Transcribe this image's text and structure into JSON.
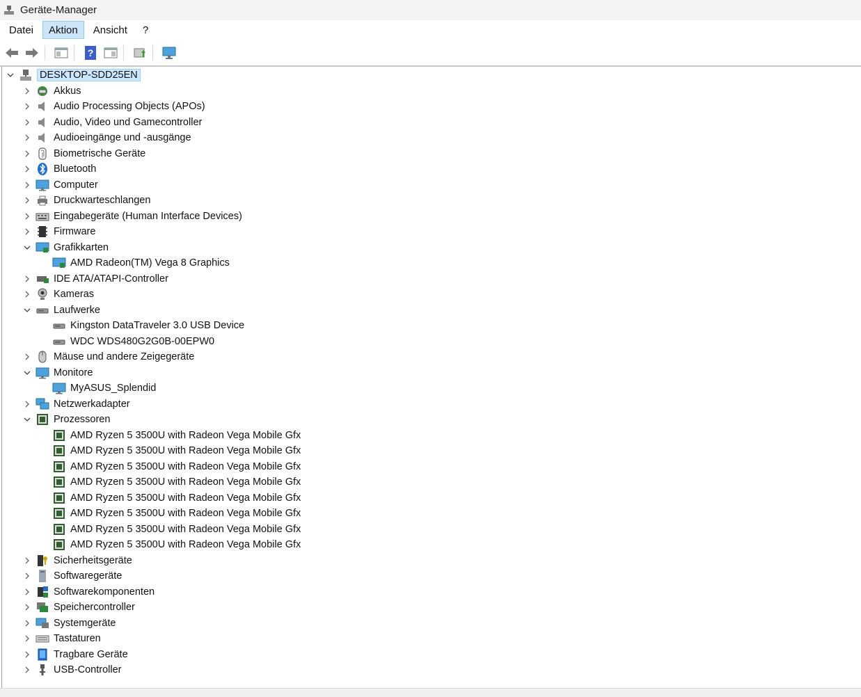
{
  "window": {
    "title": "Geräte-Manager"
  },
  "menu": [
    {
      "label": "Datei",
      "active": false
    },
    {
      "label": "Aktion",
      "active": true
    },
    {
      "label": "Ansicht",
      "active": false
    },
    {
      "label": "?",
      "active": false
    }
  ],
  "toolbar": {
    "buttons": [
      {
        "name": "back-icon"
      },
      {
        "name": "forward-icon"
      },
      {
        "name": "sep"
      },
      {
        "name": "show-hide-console-tree-icon"
      },
      {
        "name": "sep"
      },
      {
        "name": "help-icon"
      },
      {
        "name": "properties-icon"
      },
      {
        "name": "sep"
      },
      {
        "name": "update-driver-icon"
      },
      {
        "name": "sep"
      },
      {
        "name": "scan-hardware-icon"
      }
    ]
  },
  "tree": {
    "root": {
      "label": "DESKTOP-SDD25EN",
      "icon": "computer-root-icon",
      "expanded": true,
      "selected": true
    },
    "items": [
      {
        "label": "Akkus",
        "icon": "battery-icon",
        "level": 1,
        "expander": "collapsed"
      },
      {
        "label": "Audio Processing Objects (APOs)",
        "icon": "speaker-icon",
        "level": 1,
        "expander": "collapsed"
      },
      {
        "label": "Audio, Video und Gamecontroller",
        "icon": "speaker-icon",
        "level": 1,
        "expander": "collapsed"
      },
      {
        "label": "Audioeingänge und -ausgänge",
        "icon": "speaker-icon",
        "level": 1,
        "expander": "collapsed"
      },
      {
        "label": "Biometrische Geräte",
        "icon": "fingerprint-icon",
        "level": 1,
        "expander": "collapsed"
      },
      {
        "label": "Bluetooth",
        "icon": "bluetooth-icon",
        "level": 1,
        "expander": "collapsed"
      },
      {
        "label": "Computer",
        "icon": "monitor-icon",
        "level": 1,
        "expander": "collapsed"
      },
      {
        "label": "Druckwarteschlangen",
        "icon": "printer-icon",
        "level": 1,
        "expander": "collapsed"
      },
      {
        "label": "Eingabegeräte (Human Interface Devices)",
        "icon": "hid-icon",
        "level": 1,
        "expander": "collapsed"
      },
      {
        "label": "Firmware",
        "icon": "firmware-chip-icon",
        "level": 1,
        "expander": "collapsed"
      },
      {
        "label": "Grafikkarten",
        "icon": "display-adapter-icon",
        "level": 1,
        "expander": "expanded"
      },
      {
        "label": "AMD Radeon(TM) Vega 8 Graphics",
        "icon": "display-adapter-icon",
        "level": 2,
        "expander": "none"
      },
      {
        "label": "IDE ATA/ATAPI-Controller",
        "icon": "ide-controller-icon",
        "level": 1,
        "expander": "collapsed"
      },
      {
        "label": "Kameras",
        "icon": "webcam-icon",
        "level": 1,
        "expander": "collapsed"
      },
      {
        "label": "Laufwerke",
        "icon": "disk-drive-icon",
        "level": 1,
        "expander": "expanded"
      },
      {
        "label": "Kingston DataTraveler 3.0 USB Device",
        "icon": "disk-drive-icon",
        "level": 2,
        "expander": "none"
      },
      {
        "label": "WDC WDS480G2G0B-00EPW0",
        "icon": "disk-drive-icon",
        "level": 2,
        "expander": "none"
      },
      {
        "label": "Mäuse und andere Zeigegeräte",
        "icon": "mouse-icon",
        "level": 1,
        "expander": "collapsed"
      },
      {
        "label": "Monitore",
        "icon": "monitor-icon",
        "level": 1,
        "expander": "expanded"
      },
      {
        "label": "MyASUS_Splendid",
        "icon": "monitor-icon",
        "level": 2,
        "expander": "none"
      },
      {
        "label": "Netzwerkadapter",
        "icon": "network-adapter-icon",
        "level": 1,
        "expander": "collapsed"
      },
      {
        "label": "Prozessoren",
        "icon": "processor-icon",
        "level": 1,
        "expander": "expanded"
      },
      {
        "label": "AMD Ryzen 5 3500U with Radeon Vega Mobile Gfx",
        "icon": "processor-icon",
        "level": 2,
        "expander": "none"
      },
      {
        "label": "AMD Ryzen 5 3500U with Radeon Vega Mobile Gfx",
        "icon": "processor-icon",
        "level": 2,
        "expander": "none"
      },
      {
        "label": "AMD Ryzen 5 3500U with Radeon Vega Mobile Gfx",
        "icon": "processor-icon",
        "level": 2,
        "expander": "none"
      },
      {
        "label": "AMD Ryzen 5 3500U with Radeon Vega Mobile Gfx",
        "icon": "processor-icon",
        "level": 2,
        "expander": "none"
      },
      {
        "label": "AMD Ryzen 5 3500U with Radeon Vega Mobile Gfx",
        "icon": "processor-icon",
        "level": 2,
        "expander": "none"
      },
      {
        "label": "AMD Ryzen 5 3500U with Radeon Vega Mobile Gfx",
        "icon": "processor-icon",
        "level": 2,
        "expander": "none"
      },
      {
        "label": "AMD Ryzen 5 3500U with Radeon Vega Mobile Gfx",
        "icon": "processor-icon",
        "level": 2,
        "expander": "none"
      },
      {
        "label": "AMD Ryzen 5 3500U with Radeon Vega Mobile Gfx",
        "icon": "processor-icon",
        "level": 2,
        "expander": "none"
      },
      {
        "label": "Sicherheitsgeräte",
        "icon": "security-device-icon",
        "level": 1,
        "expander": "collapsed"
      },
      {
        "label": "Softwaregeräte",
        "icon": "software-device-icon",
        "level": 1,
        "expander": "collapsed"
      },
      {
        "label": "Softwarekomponenten",
        "icon": "software-component-icon",
        "level": 1,
        "expander": "collapsed"
      },
      {
        "label": "Speichercontroller",
        "icon": "storage-controller-icon",
        "level": 1,
        "expander": "collapsed"
      },
      {
        "label": "Systemgeräte",
        "icon": "system-device-icon",
        "level": 1,
        "expander": "collapsed"
      },
      {
        "label": "Tastaturen",
        "icon": "keyboard-icon",
        "level": 1,
        "expander": "collapsed"
      },
      {
        "label": "Tragbare Geräte",
        "icon": "portable-device-icon",
        "level": 1,
        "expander": "collapsed"
      },
      {
        "label": "USB-Controller",
        "icon": "usb-icon",
        "level": 1,
        "expander": "collapsed"
      }
    ]
  },
  "colors": {
    "selection_bg": "#cce8ff",
    "menu_active_bg": "#cce4f7",
    "titlebar_bg": "#f3f3f3"
  }
}
